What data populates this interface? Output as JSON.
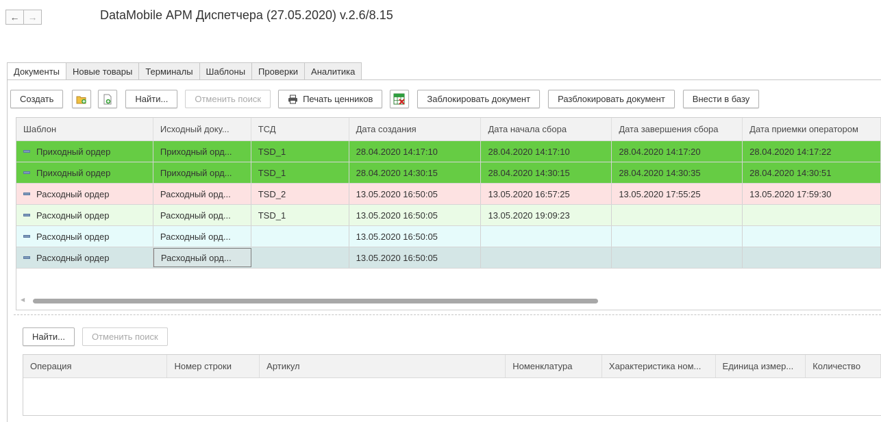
{
  "window": {
    "title": "DataMobile АРМ Диспетчера (27.05.2020) v.2.6/8.15"
  },
  "nav": {
    "back": "←",
    "forward": "→"
  },
  "tabs": [
    {
      "label": "Документы"
    },
    {
      "label": "Новые товары"
    },
    {
      "label": "Терминалы"
    },
    {
      "label": "Шаблоны"
    },
    {
      "label": "Проверки"
    },
    {
      "label": "Аналитика"
    }
  ],
  "toolbar": {
    "create": "Создать",
    "find": "Найти...",
    "cancel_search": "Отменить поиск",
    "print_prices": "Печать ценников",
    "lock_doc": "Заблокировать документ",
    "unlock_doc": "Разблокировать документ",
    "add_to_db": "Внести в базу"
  },
  "documents_table": {
    "columns": [
      "Шаблон",
      "Исходный доку...",
      "ТСД",
      "Дата создания",
      "Дата начала сбора",
      "Дата завершения сбора",
      "Дата приемки оператором"
    ],
    "rows": [
      {
        "cells": [
          "Приходный ордер",
          "Приходный орд...",
          "TSD_1",
          "28.04.2020 14:17:10",
          "28.04.2020 14:17:10",
          "28.04.2020 14:17:20",
          "28.04.2020 14:17:22"
        ],
        "bg": "#66cc44"
      },
      {
        "cells": [
          "Приходный ордер",
          "Приходный орд...",
          "TSD_1",
          "28.04.2020 14:30:15",
          "28.04.2020 14:30:15",
          "28.04.2020 14:30:35",
          "28.04.2020 14:30:51"
        ],
        "bg": "#66cc44"
      },
      {
        "cells": [
          "Расходный ордер",
          "Расходный орд...",
          "TSD_2",
          "13.05.2020 16:50:05",
          "13.05.2020 16:57:25",
          "13.05.2020 17:55:25",
          "13.05.2020 17:59:30"
        ],
        "bg": "#fde2e2"
      },
      {
        "cells": [
          "Расходный ордер",
          "Расходный орд...",
          "TSD_1",
          "13.05.2020 16:50:05",
          "13.05.2020 19:09:23",
          "",
          ""
        ],
        "bg": "#eafbe6"
      },
      {
        "cells": [
          "Расходный ордер",
          "Расходный орд...",
          "",
          "13.05.2020 16:50:05",
          "",
          "",
          ""
        ],
        "bg": "#e6fbfb"
      },
      {
        "cells": [
          "Расходный ордер",
          "Расходный орд...",
          "",
          "13.05.2020 16:50:05",
          "",
          "",
          ""
        ],
        "bg": "#d4e6e6"
      }
    ]
  },
  "lower_toolbar": {
    "find": "Найти...",
    "cancel_search": "Отменить поиск"
  },
  "lines_table": {
    "columns": [
      "Операция",
      "Номер строки",
      "Артикул",
      "Номенклатура",
      "Характеристика ном...",
      "Единица измер...",
      "Количество"
    ]
  },
  "colors": {
    "row_done": "#66cc44",
    "row_pink": "#fde2e2",
    "row_light_green": "#eafbe6",
    "row_light_cyan": "#e6fbfb",
    "row_selected": "#d4e6e6"
  }
}
